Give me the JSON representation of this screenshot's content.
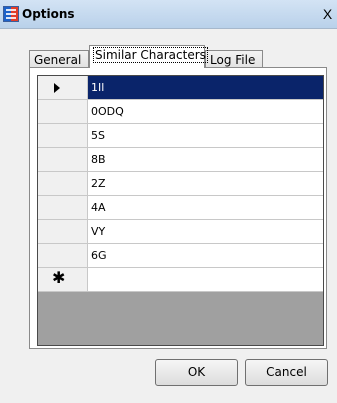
{
  "window": {
    "title": "Options",
    "close_label": "X"
  },
  "tabs": [
    {
      "label": "General"
    },
    {
      "label": "Similar Characters"
    },
    {
      "label": "Log File"
    }
  ],
  "grid": {
    "rows": [
      {
        "value": "1Il"
      },
      {
        "value": "0ODQ"
      },
      {
        "value": "5S"
      },
      {
        "value": "8B"
      },
      {
        "value": "2Z"
      },
      {
        "value": "4A"
      },
      {
        "value": "VY"
      },
      {
        "value": "6G"
      }
    ],
    "new_row_marker": "✱",
    "selected_row_color": "#0a246a"
  },
  "buttons": {
    "ok_label": "OK",
    "cancel_label": "Cancel"
  }
}
